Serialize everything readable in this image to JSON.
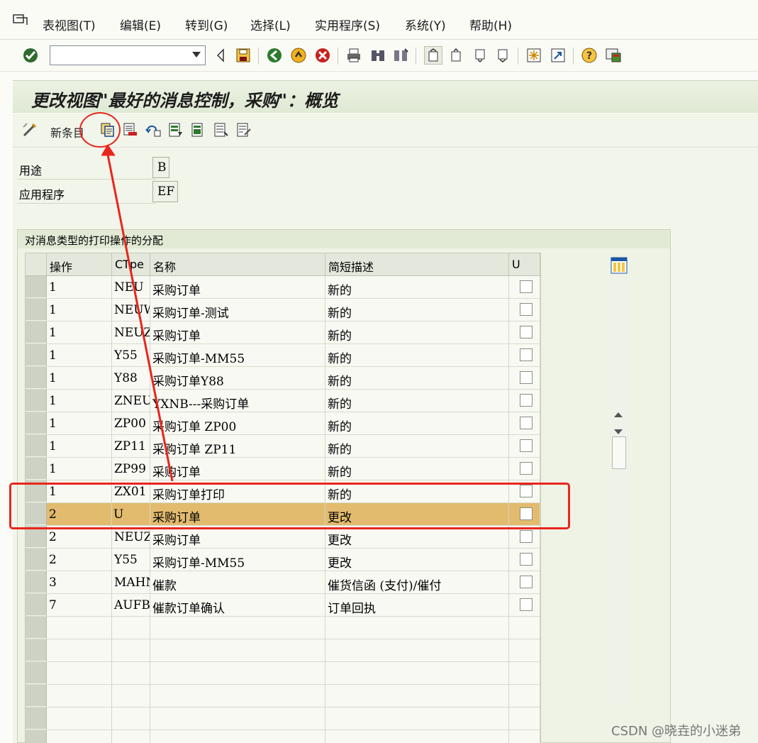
{
  "menubar": {
    "items": [
      {
        "label": "表视图(T)"
      },
      {
        "label": "编辑(E)"
      },
      {
        "label": "转到(G)"
      },
      {
        "label": "选择(L)"
      },
      {
        "label": "实用程序(S)"
      },
      {
        "label": "系统(Y)"
      },
      {
        "label": "帮助(H)"
      }
    ]
  },
  "toolbar": {
    "command_value": ""
  },
  "title": "更改视图\"最好的消息控制，采购\"：概览",
  "app_toolbar": {
    "new_entries_label": "新条目"
  },
  "key_fields": {
    "usage_label": "用途",
    "usage_value": "B",
    "application_label": "应用程序",
    "application_value": "EF"
  },
  "group": {
    "title": "对消息类型的打印操作的分配"
  },
  "table": {
    "headers": [
      "操作",
      "CTpe",
      "名称",
      "简短描述",
      "U"
    ],
    "rows": [
      {
        "op": "1",
        "ctype": "NEU",
        "name": "采购订单",
        "desc": "新的",
        "u": false
      },
      {
        "op": "1",
        "ctype": "NEUW",
        "name": "采购订单-测试",
        "desc": "新的",
        "u": false
      },
      {
        "op": "1",
        "ctype": "NEUZ",
        "name": "采购订单",
        "desc": "新的",
        "u": false
      },
      {
        "op": "1",
        "ctype": "Y55",
        "name": "采购订单-MM55",
        "desc": "新的",
        "u": false
      },
      {
        "op": "1",
        "ctype": "Y88",
        "name": "采购订单Y88",
        "desc": "新的",
        "u": false
      },
      {
        "op": "1",
        "ctype": "ZNEU",
        "name": "YXNB---采购订单",
        "desc": "新的",
        "u": false
      },
      {
        "op": "1",
        "ctype": "ZP00",
        "name": "采购订单  ZP00",
        "desc": "新的",
        "u": false
      },
      {
        "op": "1",
        "ctype": "ZP11",
        "name": "采购订单  ZP11",
        "desc": "新的",
        "u": false
      },
      {
        "op": "1",
        "ctype": "ZP99",
        "name": "采购订单",
        "desc": "新的",
        "u": false
      },
      {
        "op": "1",
        "ctype": "ZX01",
        "name": "采购订单打印",
        "desc": "新的",
        "u": false
      },
      {
        "op": "2",
        "ctype": "U",
        "name": "采购订单",
        "desc": "更改",
        "u": false,
        "selected": true
      },
      {
        "op": "2",
        "ctype": "NEUZ",
        "name": "采购订单",
        "desc": "更改",
        "u": false
      },
      {
        "op": "2",
        "ctype": "Y55",
        "name": "采购订单-MM55",
        "desc": "更改",
        "u": false
      },
      {
        "op": "3",
        "ctype": "MAHN",
        "name": "催款",
        "desc": "催货信函 (支付)/催付",
        "u": false
      },
      {
        "op": "7",
        "ctype": "AUFB",
        "name": "催款订单确认",
        "desc": "订单回执",
        "u": false
      }
    ],
    "empty_rows": 6
  },
  "watermark": "CSDN @晓垚的小迷弟",
  "colors": {
    "selected_row": "#e3bb6e",
    "annotation_red": "#e8261d",
    "title_green": "#dfe9d4"
  }
}
